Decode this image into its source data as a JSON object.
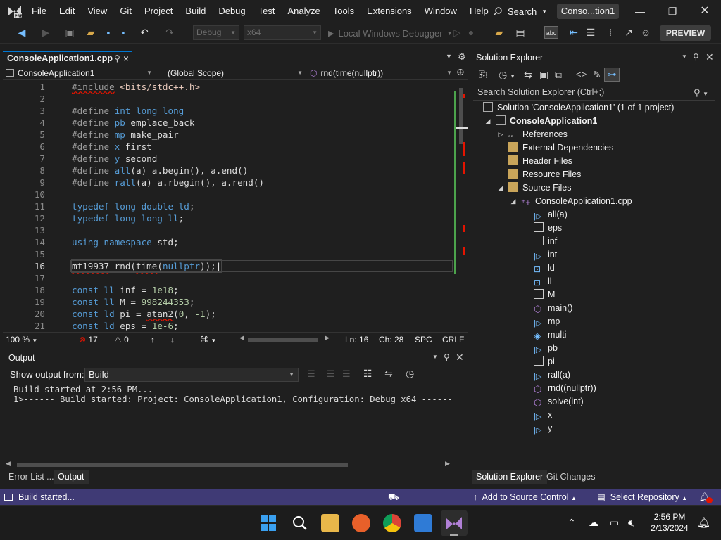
{
  "menu": {
    "items": [
      "File",
      "Edit",
      "View",
      "Git",
      "Project",
      "Build",
      "Debug",
      "Test",
      "Analyze",
      "Tools",
      "Extensions",
      "Window",
      "Help"
    ],
    "search_label": "Search",
    "solution_title": "Conso...tion1"
  },
  "toolbar": {
    "config": "Debug",
    "platform": "x64",
    "run_target": "Local Windows Debugger",
    "preview_label": "PREVIEW"
  },
  "editor": {
    "tab_title": "ConsoleApplication1.cpp",
    "nav_project": "ConsoleApplication1",
    "nav_scope": "(Global Scope)",
    "nav_member": "rnd(time(nullptr))",
    "current_line": 16,
    "lines": [
      "#include <bits/stdc++.h>",
      "",
      "#define int long long",
      "#define pb emplace_back",
      "#define mp make_pair",
      "#define x first",
      "#define y second",
      "#define all(a) a.begin(), a.end()",
      "#define rall(a) a.rbegin(), a.rend()",
      "",
      "typedef long double ld;",
      "typedef long long ll;",
      "",
      "using namespace std;",
      "",
      "mt19937 rnd(time(nullptr));",
      "",
      "const ll inf = 1e18;",
      "const ll M = 998244353;",
      "const ld pi = atan2(0, -1);",
      "const ld eps = 1e-6;"
    ],
    "zoom": "100 %",
    "errors": "17",
    "warnings": "0",
    "ln": "Ln: 16",
    "ch": "Ch: 28",
    "spc": "SPC",
    "crlf": "CRLF"
  },
  "output": {
    "title": "Output",
    "show_from_label": "Show output from:",
    "source": "Build",
    "lines": [
      "Build started at 2:56 PM...",
      "1>------ Build started: Project: ConsoleApplication1, Configuration: Debug x64 ------"
    ]
  },
  "bottom_tabs": [
    "Error List ...",
    "Output"
  ],
  "solution_explorer": {
    "title": "Solution Explorer",
    "search_placeholder": "Search Solution Explorer (Ctrl+;)",
    "solution": "Solution 'ConsoleApplication1' (1 of 1 project)",
    "project": "ConsoleApplication1",
    "folders": [
      "References",
      "External Dependencies",
      "Header Files",
      "Resource Files",
      "Source Files"
    ],
    "file": "ConsoleApplication1.cpp",
    "symbols": [
      "all(a)",
      "eps",
      "inf",
      "int",
      "ld",
      "ll",
      "M",
      "main()",
      "mp",
      "multi",
      "pb",
      "pi",
      "rall(a)",
      "rnd((nullptr))",
      "solve(int)",
      "x",
      "y"
    ],
    "tabs": [
      "Solution Explorer",
      "Git Changes"
    ]
  },
  "status": {
    "message": "Build started...",
    "source_control": "Add to Source Control",
    "repo": "Select Repository"
  },
  "taskbar": {
    "time": "2:56 PM",
    "date": "2/13/2024"
  },
  "colors": {
    "accent": "#0078d4",
    "statusbar": "#3f3a75",
    "keyword": "#569cd6",
    "error": "#e51400"
  }
}
